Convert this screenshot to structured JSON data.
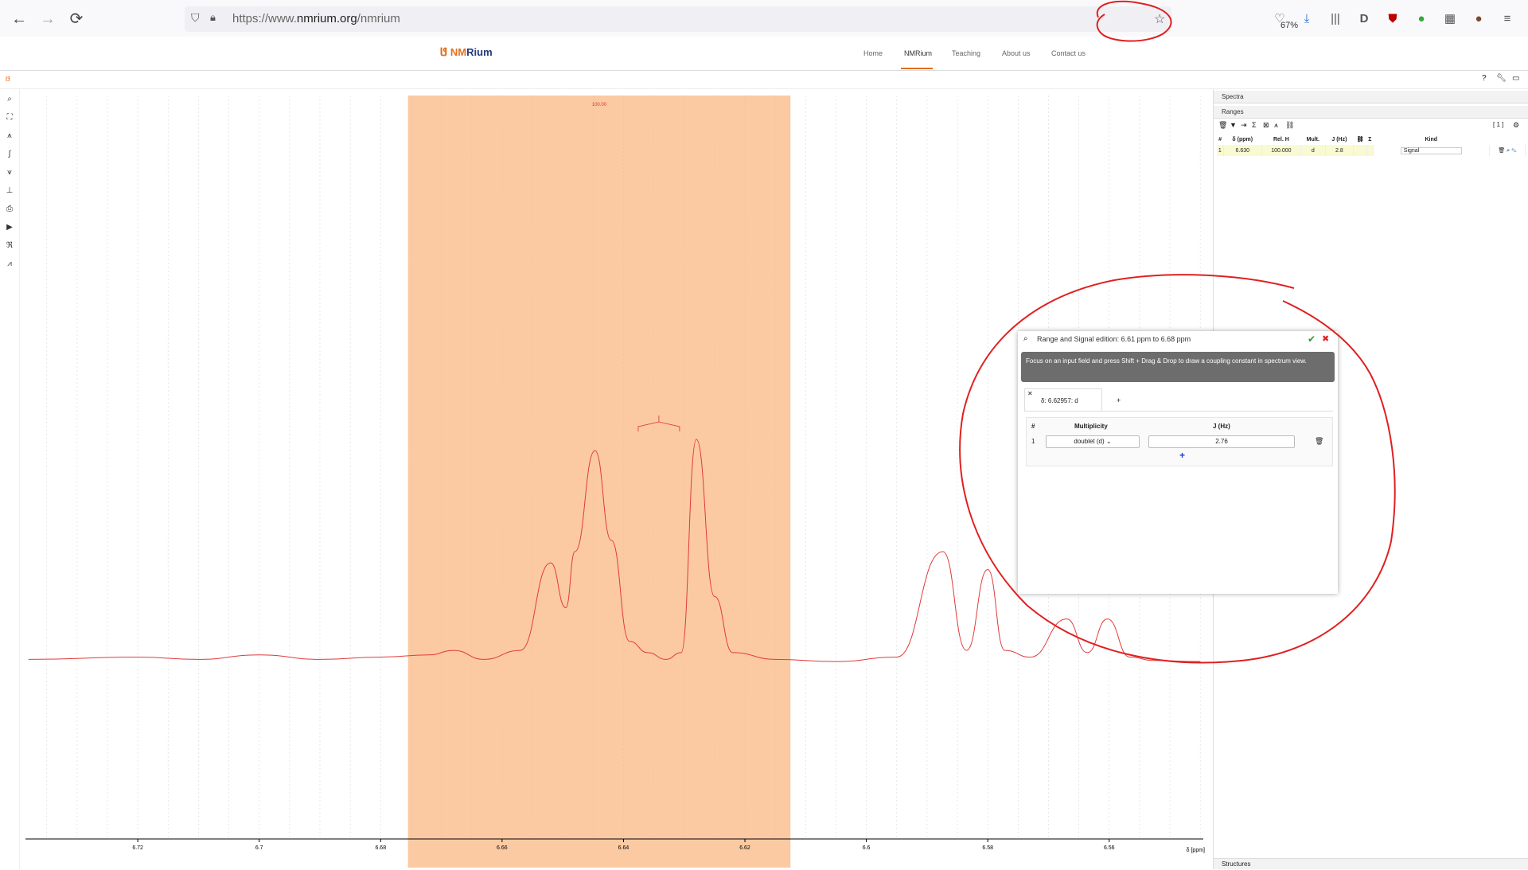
{
  "browser": {
    "url_prefix": "https://www.",
    "url_host": "nmrium.org",
    "url_path": "/nmrium",
    "zoom": "67%"
  },
  "site": {
    "logo_a": "NM",
    "logo_b": "Rium",
    "nav": [
      "Home",
      "NMRium",
      "Teaching",
      "About us",
      "Contact us"
    ]
  },
  "spectrum": {
    "range_label": "100.00",
    "axis_unit": "δ [ppm]"
  },
  "panel": {
    "spectra_label": "Spectra",
    "ranges_label": "Ranges",
    "ranges_count": "[ 1 ]",
    "columns": [
      "#",
      "δ (ppm)",
      "Rel. H",
      "Mult.",
      "J (Hz)",
      "",
      "Σ",
      "Kind",
      ""
    ],
    "row": {
      "index": "1",
      "delta": "6.630",
      "rel_h": "100.000",
      "mult": "d",
      "j": "2.8",
      "kind": "Signal"
    },
    "structures_label": "Structures"
  },
  "dialog": {
    "title": "Range and Signal edition: 6.61 ppm to 6.68 ppm",
    "hint": "Focus on an input field and press Shift + Drag & Drop to draw a coupling constant in spectrum view.",
    "tab_label": "δ: 6.62957: d",
    "col_index": "#",
    "col_mult": "Multiplicity",
    "col_j": "J (Hz)",
    "row_index": "1",
    "mult_value": "doublet (d)",
    "j_value": "2.76",
    "add_label": "+"
  },
  "chart_data": {
    "type": "line",
    "title": "",
    "xlabel": "δ [ppm]",
    "x_ticks": [
      6.72,
      6.7,
      6.68,
      6.66,
      6.64,
      6.62,
      6.6,
      6.58,
      6.56
    ],
    "xlim": [
      6.7385,
      6.5445
    ],
    "highlighted_range_ppm": [
      6.6755,
      6.6125
    ],
    "series": [
      {
        "color": "#e03a3a",
        "x": [
          6.738,
          6.72,
          6.71,
          6.7,
          6.69,
          6.68,
          6.672,
          6.668,
          6.663,
          6.657,
          6.652,
          6.6495,
          6.648,
          6.6447,
          6.642,
          6.639,
          6.636,
          6.633,
          6.6305,
          6.628,
          6.625,
          6.622,
          6.615,
          6.605,
          6.595,
          6.5874,
          6.5835,
          6.58,
          6.5772,
          6.573,
          6.567,
          6.5636,
          6.5603,
          6.5566,
          6.5527,
          6.545
        ],
        "y": [
          0.02,
          0.03,
          0.02,
          0.04,
          0.02,
          0.03,
          0.04,
          0.06,
          0.02,
          0.06,
          0.45,
          0.25,
          0.5,
          0.95,
          0.55,
          0.1,
          0.05,
          0.02,
          0.05,
          1.0,
          0.3,
          0.05,
          0.02,
          0.01,
          0.03,
          0.5,
          0.06,
          0.42,
          0.06,
          0.03,
          0.2,
          0.05,
          0.2,
          0.03,
          0.015,
          0.01
        ]
      }
    ]
  },
  "annotation": {
    "color": "#e02020"
  }
}
